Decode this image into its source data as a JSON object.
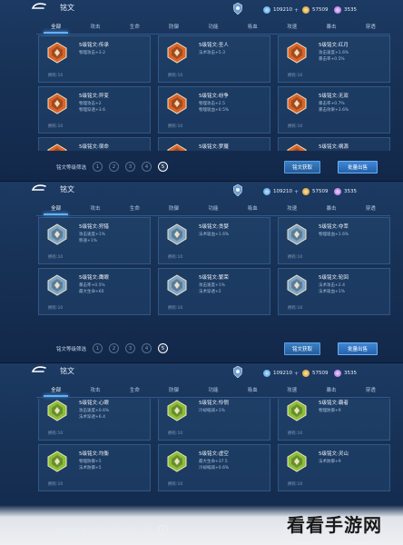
{
  "header": {
    "title": "铭文",
    "coins": "109210",
    "gold": "57509",
    "gems": "3535"
  },
  "tabs": [
    "全部",
    "攻击",
    "生命",
    "防御",
    "功能",
    "吸血",
    "攻速",
    "暴击",
    "穿透"
  ],
  "bottom": {
    "filter_label": "铭文等级筛选",
    "levels": [
      "1",
      "2",
      "3",
      "4",
      "5"
    ],
    "active_level": 4,
    "get_button": "铭文获取",
    "sell_button": "批量出售"
  },
  "panels": [
    {
      "cards": [
        {
          "name": "5级铭文:传承",
          "stats": [
            "物理攻击+3.2"
          ],
          "owned": "拥有:10",
          "color": "#d9642a"
        },
        {
          "name": "5级铭文:圣人",
          "stats": [
            "法术攻击+5.3"
          ],
          "owned": "拥有:10",
          "color": "#d9642a"
        },
        {
          "name": "5级铭文:红月",
          "stats": [
            "攻击速度+1.6%",
            "暴击率+0.5%"
          ],
          "owned": "拥有:10",
          "color": "#d9642a"
        },
        {
          "name": "5级铭文:异变",
          "stats": [
            "物理攻击+2",
            "物理穿透+3.6"
          ],
          "owned": "拥有:10",
          "color": "#d9642a"
        },
        {
          "name": "5级铭文:纷争",
          "stats": [
            "物理攻击+2.5",
            "物理吸血+0.5%"
          ],
          "owned": "拥有:10",
          "color": "#d9642a"
        },
        {
          "name": "5级铭文:无双",
          "stats": [
            "暴击率+0.7%",
            "暴击效果+3.6%"
          ],
          "owned": "拥有:10",
          "color": "#d9642a"
        },
        {
          "name": "5级铭文:宿命",
          "stats": [],
          "owned": "",
          "color": "#d9642a"
        },
        {
          "name": "5级铭文:梦魇",
          "stats": [],
          "owned": "",
          "color": "#d9642a"
        },
        {
          "name": "5级铭文:祸源",
          "stats": [],
          "owned": "",
          "color": "#d9642a"
        }
      ]
    },
    {
      "cards": [
        {
          "name": "5级铭文:狩猎",
          "stats": [
            "攻击速度+1%",
            "移速+1%"
          ],
          "owned": "拥有:10",
          "color": "#7ea6c8"
        },
        {
          "name": "5级铭文:贪婪",
          "stats": [
            "法术吸血+1.6%"
          ],
          "owned": "拥有:10",
          "color": "#7ea6c8"
        },
        {
          "name": "5级铭文:夺萃",
          "stats": [
            "物理吸血+1.6%"
          ],
          "owned": "拥有:10",
          "color": "#7ea6c8"
        },
        {
          "name": "5级铭文:鹰眼",
          "stats": [
            "暴击率+0.5%",
            "最大生命+60"
          ],
          "owned": "拥有:10",
          "color": "#7ea6c8"
        },
        {
          "name": "5级铭文:繁荣",
          "stats": [
            "攻击速度+1%",
            "法术穿透+2"
          ],
          "owned": "拥有:10",
          "color": "#7ea6c8"
        },
        {
          "name": "5级铭文:轮回",
          "stats": [
            "法术攻击+2.4",
            "法术吸血+1%"
          ],
          "owned": "拥有:10",
          "color": "#7ea6c8"
        }
      ]
    },
    {
      "cards": [
        {
          "name": "5级铭文:心眼",
          "stats": [
            "攻击速度+0.6%",
            "法术穿透+6.4"
          ],
          "owned": "拥有:10",
          "color": "#8cbf3a"
        },
        {
          "name": "5级铭文:怜悯",
          "stats": [
            "冷却缩减+1%"
          ],
          "owned": "拥有:10",
          "color": "#8cbf3a"
        },
        {
          "name": "5级铭文:霸者",
          "stats": [
            "物理防御+9"
          ],
          "owned": "拥有:10",
          "color": "#8cbf3a"
        },
        {
          "name": "5级铭文:均衡",
          "stats": [
            "物理防御+5",
            "法术防御+5"
          ],
          "owned": "拥有:10",
          "color": "#8cbf3a"
        },
        {
          "name": "5级铭文:虚空",
          "stats": [
            "最大生命+37.5",
            "冷却缩减+0.6%"
          ],
          "owned": "拥有:10",
          "color": "#8cbf3a"
        },
        {
          "name": "5级铭文:灵山",
          "stats": [
            "法术防御+9"
          ],
          "owned": "拥有:10",
          "color": "#8cbf3a"
        }
      ]
    }
  ],
  "watermark": "看看手游网"
}
